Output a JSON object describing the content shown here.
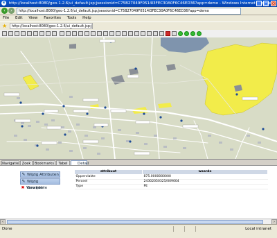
{
  "window": {
    "title": "http://localhost:8080/geo-1.2.6/ui_default.jsp;jsessionid=C75B27049F0514I3FEC30A0F6C46ED36?app=demo - Windows Internet Explorer",
    "buttons": [
      "_",
      "□",
      "×"
    ]
  },
  "address_bar": {
    "url": "http://localhost:8080/geo-1.2.6/ui_default.jsp;jsessionid=C75B27049F0514I3FEC30A0F6C46ED36?app=demo"
  },
  "menu": [
    "File",
    "Edit",
    "View",
    "Favorites",
    "Tools",
    "Help"
  ],
  "fav_tab": {
    "label": "http://localhost:8080/geo-1.2.6/ui_default.jsp;jsessi..."
  },
  "map": {
    "colors": {
      "background": "#d8dcc6",
      "yellow_parcel": "#f2ec4a",
      "road": "#ffffff",
      "building": "#8a8f96",
      "water": "#7f94ad",
      "point": "#1e4c96"
    }
  },
  "tabs": [
    "Navigatie",
    "Zoek",
    "Bookmarks",
    "Tabel",
    "Detail"
  ],
  "active_tab": "Detail",
  "actions": [
    {
      "label": "Wijzig Attributen",
      "icon": "edit-icon"
    },
    {
      "label": "Wijzig Geometrie",
      "icon": "geometry-icon"
    },
    {
      "label": "Verwijder",
      "icon": "delete-icon"
    }
  ],
  "attribute_table": {
    "headers": [
      "attribuut",
      "waarde"
    ],
    "rows": [
      [
        "Oppervlakte",
        "875.0000000000"
      ],
      [
        "Perceel",
        "24302050325/009004"
      ],
      [
        "Type",
        "PE"
      ]
    ]
  },
  "status": {
    "left": "Done",
    "zone": "Local intranet"
  }
}
